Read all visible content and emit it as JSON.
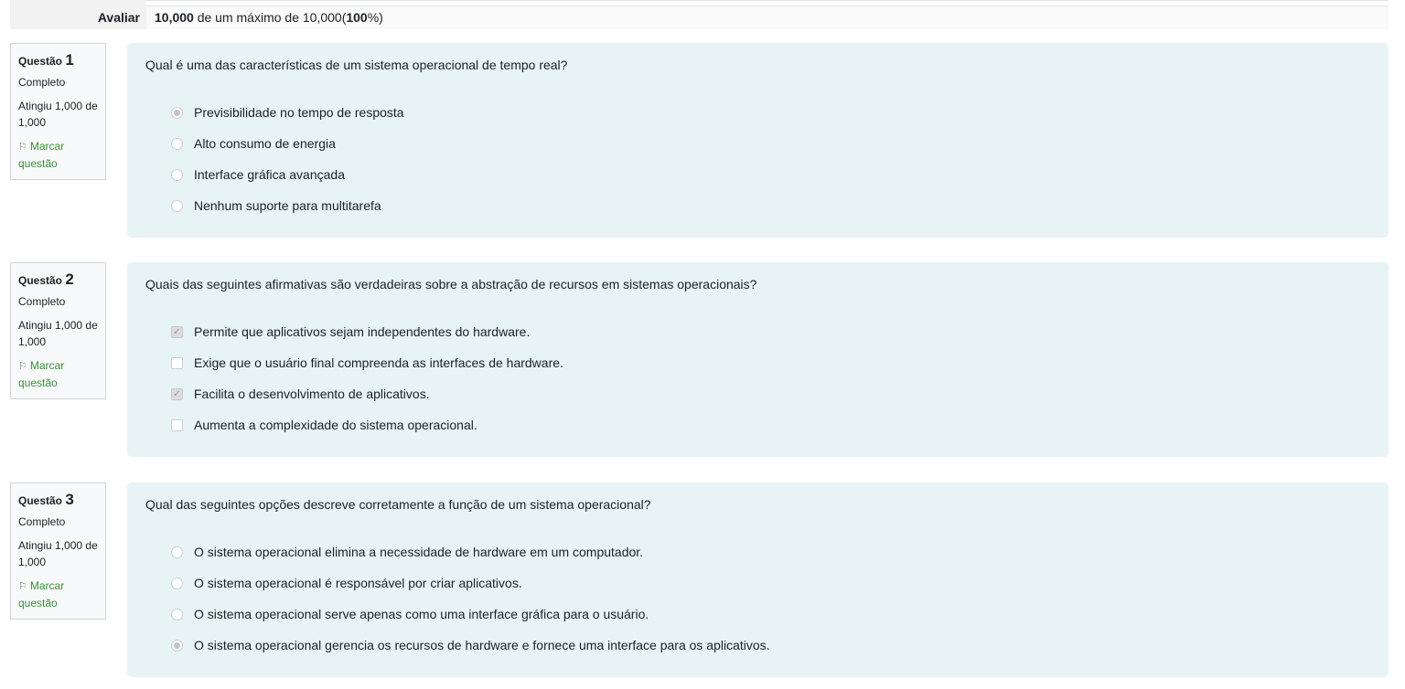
{
  "summary": {
    "label": "Avaliar",
    "score": "10,000",
    "rest": " de um máximo de 10,000(",
    "percent": "100",
    "suffix": "%)"
  },
  "questions": [
    {
      "label": "Questão",
      "number": "1",
      "state": "Completo",
      "grade": "Atingiu 1,000 de 1,000",
      "flag": "Marcar questão",
      "text": "Qual é uma das características de um sistema operacional de tempo real?",
      "type": "radio",
      "options": [
        {
          "text": "Previsibilidade no tempo de resposta",
          "checked": true
        },
        {
          "text": "Alto consumo de energia",
          "checked": false
        },
        {
          "text": "Interface gráfica avançada",
          "checked": false
        },
        {
          "text": "Nenhum suporte para multitarefa",
          "checked": false
        }
      ]
    },
    {
      "label": "Questão",
      "number": "2",
      "state": "Completo",
      "grade": "Atingiu 1,000 de 1,000",
      "flag": "Marcar questão",
      "text": "Quais das seguintes afirmativas são verdadeiras sobre a abstração de recursos em sistemas operacionais?",
      "type": "checkbox",
      "options": [
        {
          "text": "Permite que aplicativos sejam independentes do hardware.",
          "checked": true
        },
        {
          "text": "Exige que o usuário final compreenda as interfaces de hardware.",
          "checked": false
        },
        {
          "text": "Facilita o desenvolvimento de aplicativos.",
          "checked": true
        },
        {
          "text": "Aumenta a complexidade do sistema operacional.",
          "checked": false
        }
      ]
    },
    {
      "label": "Questão",
      "number": "3",
      "state": "Completo",
      "grade": "Atingiu 1,000 de 1,000",
      "flag": "Marcar questão",
      "text": "Qual das seguintes opções descreve corretamente a função de um sistema operacional?",
      "type": "radio",
      "options": [
        {
          "text": "O sistema operacional elimina a necessidade de hardware em um computador.",
          "checked": false
        },
        {
          "text": "O sistema operacional é responsável por criar aplicativos.",
          "checked": false
        },
        {
          "text": "O sistema operacional serve apenas como uma interface gráfica para o usuário.",
          "checked": false
        },
        {
          "text": "O sistema operacional gerencia os recursos de hardware e fornece uma interface para os aplicativos.",
          "checked": true
        }
      ]
    }
  ]
}
